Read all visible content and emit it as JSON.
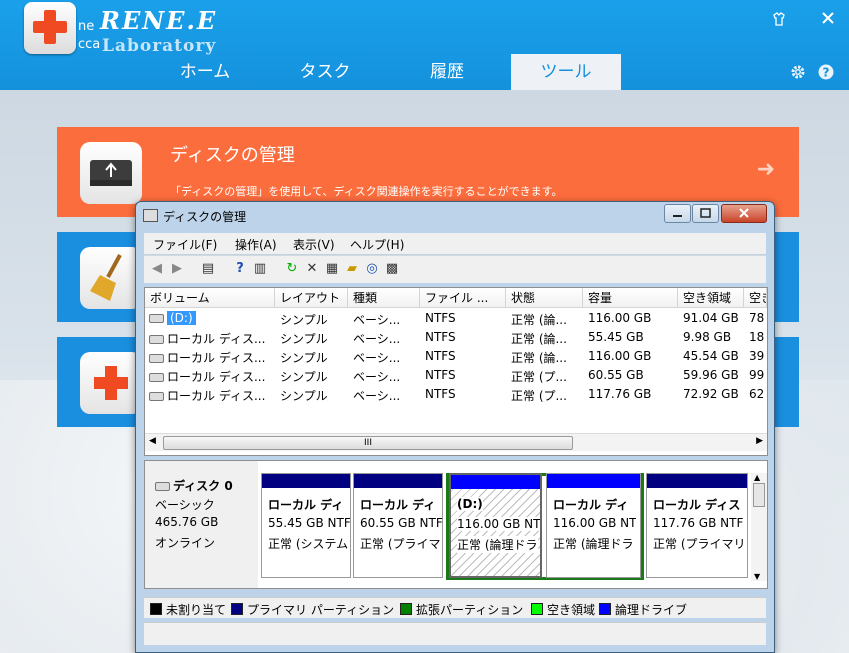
{
  "app": {
    "brand_name": "RENE.E",
    "brand_sub": "Laboratory",
    "brand_left_1": "ne",
    "brand_left_2": "cca"
  },
  "nav": {
    "tabs": [
      {
        "label": "ホーム"
      },
      {
        "label": "タスク"
      },
      {
        "label": "履歴"
      },
      {
        "label": "ツール"
      }
    ]
  },
  "card1": {
    "title": "ディスクの管理",
    "desc": "「ディスクの管理」を使用して、ディスク関連操作を実行することができます。",
    "arrow": "➜"
  },
  "window": {
    "title": "ディスクの管理",
    "menu": [
      "ファイル(F)",
      "操作(A)",
      "表示(V)",
      "ヘルプ(H)"
    ],
    "columns": [
      "ボリューム",
      "レイアウト",
      "種類",
      "ファイル ...",
      "状態",
      "容量",
      "空き領域",
      "空き"
    ],
    "rows": [
      [
        "(D:)",
        "シンプル",
        "ベーシ...",
        "NTFS",
        "正常 (論...",
        "116.00 GB",
        "91.04 GB",
        "78"
      ],
      [
        "ローカル ディス...",
        "シンプル",
        "ベーシ...",
        "NTFS",
        "正常 (論...",
        "55.45 GB",
        "9.98 GB",
        "18"
      ],
      [
        "ローカル ディス...",
        "シンプル",
        "ベーシ...",
        "NTFS",
        "正常 (論...",
        "116.00 GB",
        "45.54 GB",
        "39"
      ],
      [
        "ローカル ディス...",
        "シンプル",
        "ベーシ...",
        "NTFS",
        "正常 (プ...",
        "60.55 GB",
        "59.96 GB",
        "99"
      ],
      [
        "ローカル ディス...",
        "シンプル",
        "ベーシ...",
        "NTFS",
        "正常 (プ...",
        "117.76 GB",
        "72.92 GB",
        "62"
      ]
    ],
    "scroll_thumb": "III",
    "disk": {
      "name": "ディスク 0",
      "type": "ベーシック",
      "size": "465.76 GB",
      "status": "オンライン"
    },
    "partitions": [
      {
        "name": "ローカル ディ",
        "size": "55.45 GB NTF",
        "status": "正常 (システム",
        "bar": "#000080"
      },
      {
        "name": "ローカル ディ",
        "size": "60.55 GB NTF",
        "status": "正常 (プライマ",
        "bar": "#000080"
      },
      {
        "name": "(D:)",
        "size": "116.00 GB NT",
        "status": "正常 (論理ドラ",
        "bar": "#0000ff"
      },
      {
        "name": "ローカル ディ",
        "size": "116.00 GB NT",
        "status": "正常 (論理ドラ",
        "bar": "#0000ff"
      },
      {
        "name": "ローカル ディス",
        "size": "117.76 GB NTF",
        "status": "正常 (プライマリ",
        "bar": "#000080"
      }
    ],
    "legend": [
      {
        "label": "未割り当て",
        "color": "#000000"
      },
      {
        "label": "プライマリ パーティション",
        "color": "#000080"
      },
      {
        "label": "拡張パーティション",
        "color": "#008000"
      },
      {
        "label": "空き領域",
        "color": "#00ff00"
      },
      {
        "label": "論理ドライブ",
        "color": "#0000ff"
      }
    ]
  }
}
